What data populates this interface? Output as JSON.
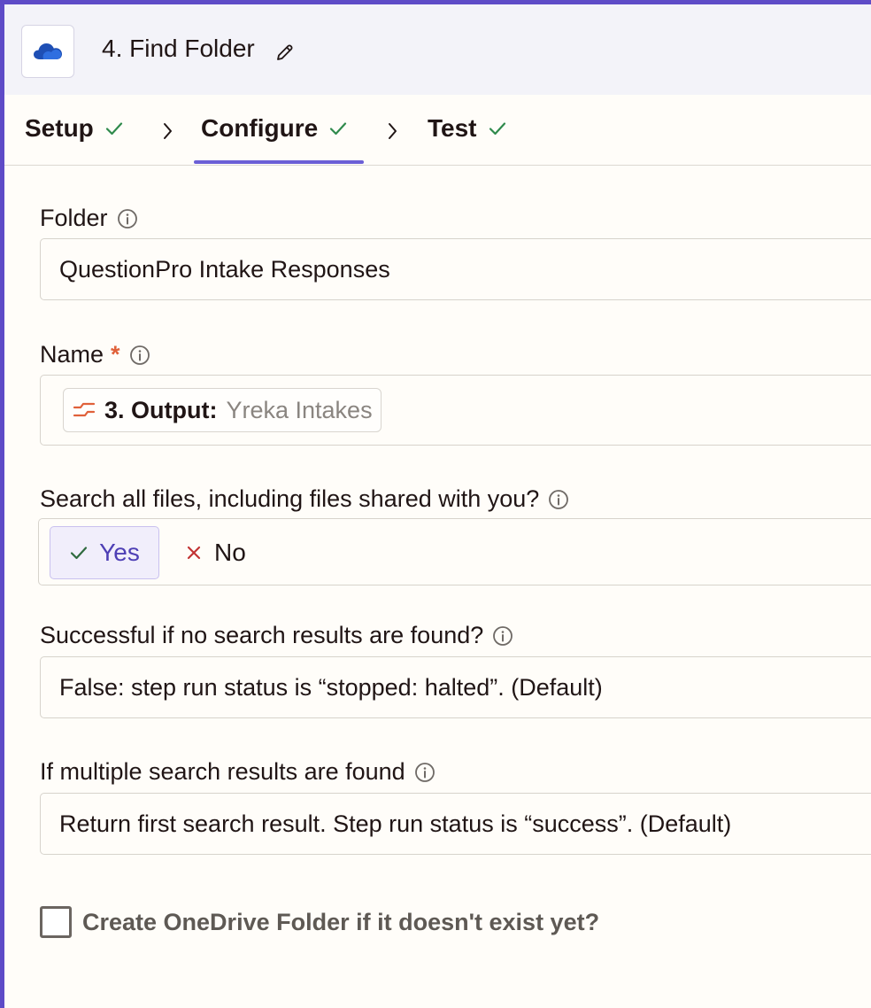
{
  "header": {
    "app_icon": "onedrive-cloud-icon",
    "step_title": "4. Find Folder",
    "edit_icon": "pencil-icon"
  },
  "tabs": [
    {
      "label": "Setup",
      "complete": true
    },
    {
      "label": "Configure",
      "complete": true,
      "active": true
    },
    {
      "label": "Test",
      "complete": true
    }
  ],
  "colors": {
    "accent": "#5e4bc7",
    "check_green": "#2f8a4c",
    "required": "#e0613a",
    "no_red": "#c23434"
  },
  "fields": {
    "folder": {
      "label": "Folder",
      "value": "QuestionPro Intake Responses"
    },
    "name": {
      "label": "Name",
      "required_mark": "*",
      "token_output_label": "3. Output:",
      "token_value": "Yreka Intakes"
    },
    "search_all": {
      "label": "Search all files, including files shared with you?",
      "yes_label": "Yes",
      "no_label": "No",
      "selected": "Yes"
    },
    "no_results": {
      "label": "Successful if no search results are found?",
      "value": "False: step run status is “stopped: halted”. (Default)"
    },
    "multiple_results": {
      "label": "If multiple search results are found",
      "value": "Return first search result. Step run status is “success”. (Default)"
    },
    "create_folder": {
      "label": "Create OneDrive Folder if it doesn't exist yet?",
      "checked": false
    }
  }
}
